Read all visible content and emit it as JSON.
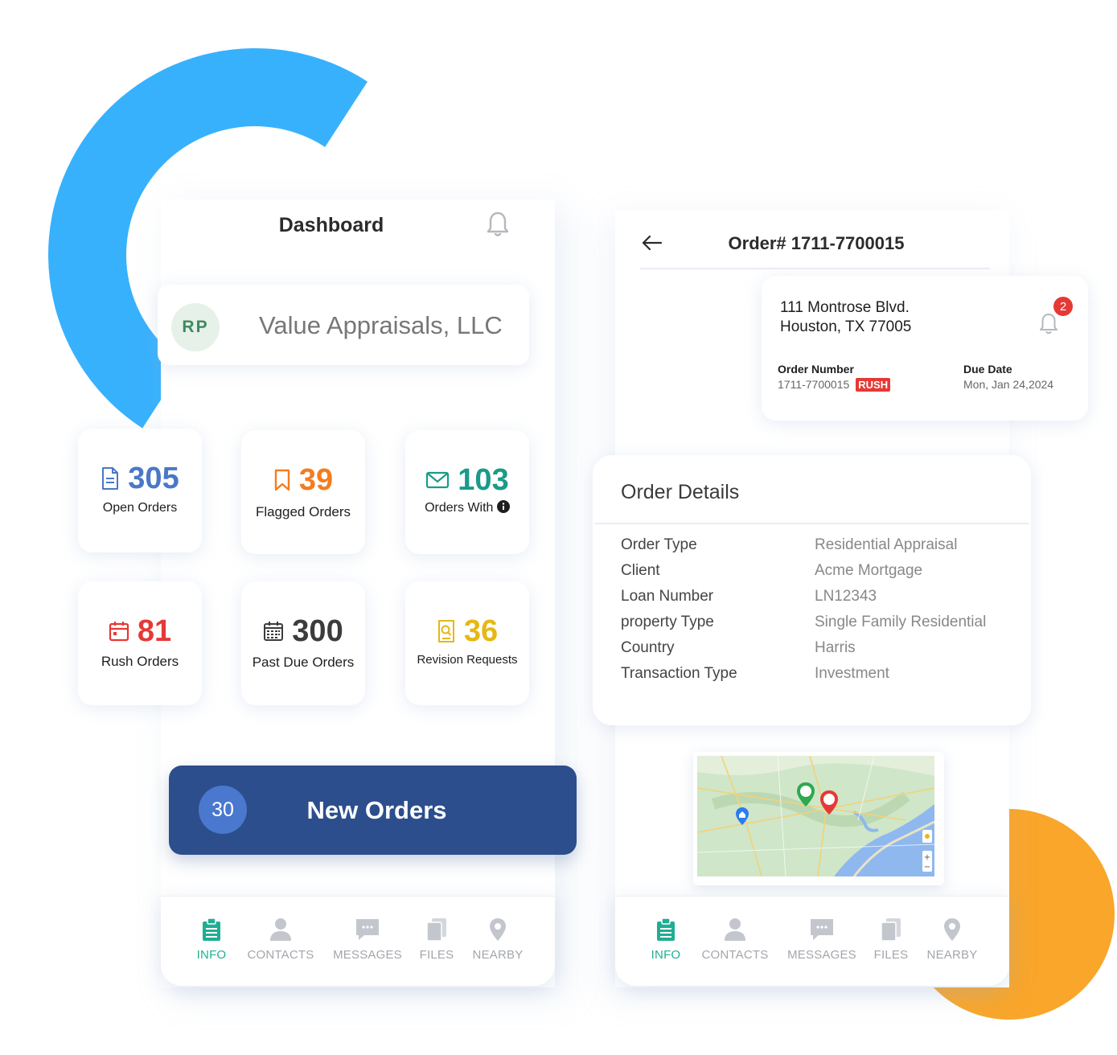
{
  "dashboard": {
    "title": "Dashboard",
    "company": {
      "initials": "RP",
      "name": "Value Appraisals, LLC"
    },
    "stats": [
      {
        "value": "305",
        "label": "Open Orders",
        "color": "#4a78c6",
        "icon": "document-icon"
      },
      {
        "value": "39",
        "label": "Flagged Orders",
        "color": "#f57c1f",
        "icon": "bookmark-icon"
      },
      {
        "value": "103",
        "label": "Orders With",
        "color": "#1a9b8a",
        "icon": "envelope-icon"
      },
      {
        "value": "81",
        "label": "Rush Orders",
        "color": "#e53935",
        "icon": "calendar-icon"
      },
      {
        "value": "300",
        "label": "Past Due Orders",
        "color": "#3c3c3c",
        "icon": "calendar-grid-icon"
      },
      {
        "value": "36",
        "label": "Revision Requests",
        "color": "#e5b814",
        "icon": "search-doc-icon"
      }
    ],
    "new_orders": {
      "count": "30",
      "label": "New Orders"
    }
  },
  "order": {
    "title": "Order# 1711-7700015",
    "address_line1": "111 Montrose Blvd.",
    "address_line2": "Houston, TX 77005",
    "notification_count": "2",
    "order_number_label": "Order Number",
    "order_number_value": "1711-7700015",
    "rush_label": "RUSH",
    "due_date_label": "Due Date",
    "due_date_value": "Mon, Jan 24,2024"
  },
  "details": {
    "title": "Order Details",
    "rows": [
      {
        "key": "Order Type",
        "value": "Residential Appraisal"
      },
      {
        "key": "Client",
        "value": "Acme Mortgage"
      },
      {
        "key": "Loan Number",
        "value": "LN12343"
      },
      {
        "key": "property Type",
        "value": "Single Family Residential"
      },
      {
        "key": "Country",
        "value": "Harris"
      },
      {
        "key": "Transaction Type",
        "value": "Investment"
      }
    ]
  },
  "nav": {
    "items": [
      {
        "label": "INFO",
        "icon": "clipboard-icon",
        "active": true
      },
      {
        "label": "CONTACTS",
        "icon": "person-icon",
        "active": false
      },
      {
        "label": "MESSAGES",
        "icon": "chat-icon",
        "active": false
      },
      {
        "label": "FILES",
        "icon": "files-icon",
        "active": false
      },
      {
        "label": "NEARBY",
        "icon": "location-pin-icon",
        "active": false
      }
    ]
  },
  "colors": {
    "accent_blue": "#38b1fd",
    "accent_orange": "#f9a62a",
    "navy": "#2c4e8c",
    "active_nav": "#1fae94"
  }
}
